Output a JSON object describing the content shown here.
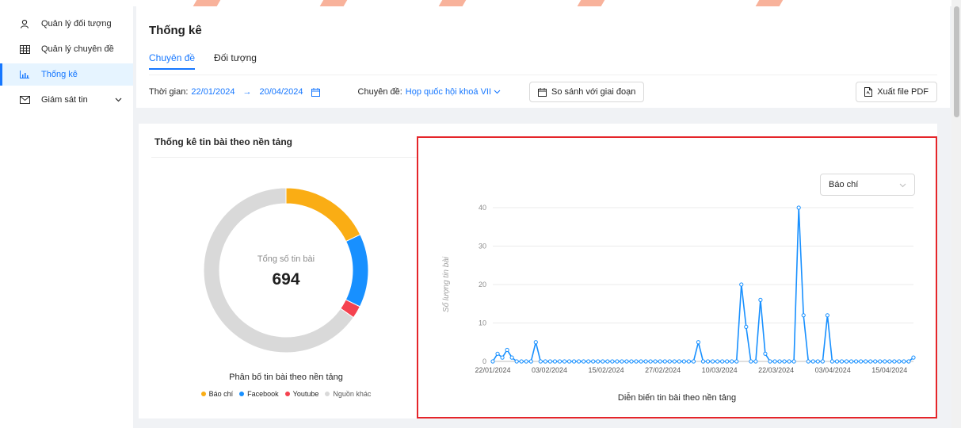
{
  "sidebar": {
    "items": [
      {
        "label": "Quản lý đối tượng",
        "icon": "user-icon"
      },
      {
        "label": "Quản lý chuyên đề",
        "icon": "table-icon"
      },
      {
        "label": "Thống kê",
        "icon": "bar-chart-icon"
      },
      {
        "label": "Giám sát tin",
        "icon": "mail-icon"
      }
    ]
  },
  "header": {
    "title": "Thống kê",
    "tabs": [
      "Chuyên đề",
      "Đối tượng"
    ],
    "time_label": "Thời gian:",
    "date_from": "22/01/2024",
    "date_arrow": "→",
    "date_to": "20/04/2024",
    "topic_label": "Chuyên đề:",
    "topic_value": "Họp quốc hội khoá VII",
    "compare_button": "So sánh với giai đoạn",
    "export_button": "Xuất file PDF"
  },
  "card": {
    "title": "Thống kê tin bài theo nền tảng",
    "donut_label": "Tổng số tin bài",
    "donut_total": "694",
    "donut_caption": "Phân bố tin bài theo nền tảng",
    "legend": [
      "Báo chí",
      "Facebook",
      "Youtube",
      "Nguồn khác"
    ],
    "platform_select": "Báo chí",
    "line_caption": "Diễn biến tin bài theo nền tảng"
  },
  "colors": {
    "primary": "#1677ff",
    "bao_chi": "#faad14",
    "facebook": "#1890ff",
    "youtube": "#f5424f",
    "nguon_khac": "#d9d9d9",
    "highlight": "#e5252a"
  },
  "chart_data": [
    {
      "type": "pie",
      "categories": [
        "Báo chí",
        "Facebook",
        "Youtube",
        "Nguồn khác"
      ],
      "values": [
        124,
        100,
        17,
        453
      ],
      "total_label": "694"
    },
    {
      "type": "line",
      "ylabel": "Số lượng tin bài",
      "ylim": [
        0,
        40
      ],
      "yticks": [
        0,
        10,
        20,
        30,
        40
      ],
      "xtick_labels": [
        "22/01/2024",
        "03/02/2024",
        "15/02/2024",
        "27/02/2024",
        "10/03/2024",
        "22/03/2024",
        "03/04/2024",
        "15/04/2024"
      ],
      "x_start": "22/01/2024",
      "x_end": "20/04/2024",
      "series": [
        {
          "values": [
            0,
            2,
            1,
            3,
            1,
            0,
            0,
            0,
            0,
            5,
            0,
            0,
            0,
            0,
            0,
            0,
            0,
            0,
            0,
            0,
            0,
            0,
            0,
            0,
            0,
            0,
            0,
            0,
            0,
            0,
            0,
            0,
            0,
            0,
            0,
            0,
            0,
            0,
            0,
            0,
            0,
            0,
            0,
            5,
            0,
            0,
            0,
            0,
            0,
            0,
            0,
            0,
            20,
            9,
            0,
            0,
            16,
            2,
            0,
            0,
            0,
            0,
            0,
            0,
            40,
            12,
            0,
            0,
            0,
            0,
            12,
            0,
            0,
            0,
            0,
            0,
            0,
            0,
            0,
            0,
            0,
            0,
            0,
            0,
            0,
            0,
            0,
            0,
            1
          ]
        }
      ],
      "grid": true
    }
  ]
}
